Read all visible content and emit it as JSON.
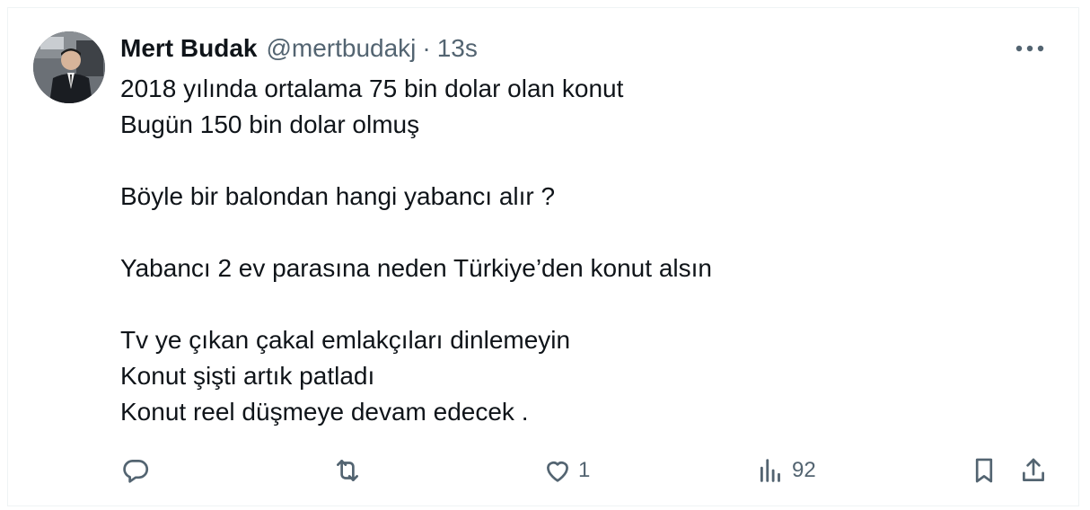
{
  "post": {
    "author": {
      "display_name": "Mert Budak",
      "handle": "@mertbudakj",
      "separator": "·",
      "time": "13s",
      "avatar_icon": "avatar-photo"
    },
    "body_lines": [
      "2018 yılında ortalama 75 bin dolar olan konut",
      "Bugün 150 bin dolar olmuş",
      "",
      "Böyle bir balondan hangi yabancı alır ?",
      "",
      "Yabancı 2 ev parasına neden Türkiye’den konut alsın",
      "",
      "Tv ye çıkan çakal emlakçıları dinlemeyin",
      "Konut şişti artık patladı",
      "Konut reel düşmeye devam edecek ."
    ],
    "more_icon": "more-horizontal-icon",
    "actions": {
      "reply": {
        "icon": "reply-icon",
        "count": ""
      },
      "repost": {
        "icon": "repost-icon",
        "count": ""
      },
      "like": {
        "icon": "like-icon",
        "count": "1"
      },
      "views": {
        "icon": "views-icon",
        "count": "92"
      },
      "bookmark": {
        "icon": "bookmark-icon"
      },
      "share": {
        "icon": "share-icon"
      }
    },
    "colors": {
      "text": "#0f1419",
      "secondary": "#536471",
      "border": "#eff3f4"
    }
  }
}
